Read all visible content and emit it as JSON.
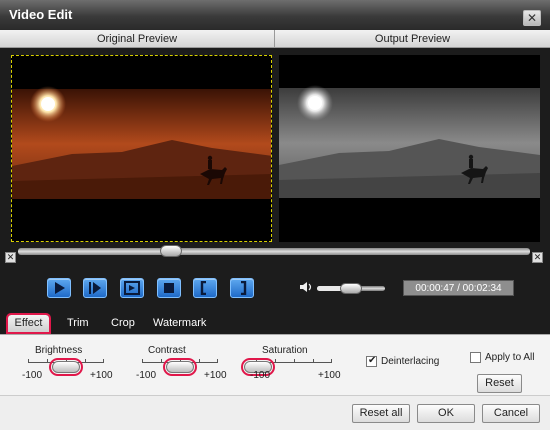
{
  "window": {
    "title": "Video Edit",
    "close_symbol": "✕"
  },
  "panes": {
    "original": "Original Preview",
    "output": "Output Preview"
  },
  "playback": {
    "seek_fraction": 0.29,
    "volume_fraction": 0.5,
    "time": "00:00:47 / 00:02:34",
    "buttons": [
      "play-icon",
      "next-frame-icon",
      "snapshot-icon",
      "stop-icon",
      "mark-start-icon",
      "mark-end-icon"
    ]
  },
  "tabs": [
    "Effect",
    "Trim",
    "Crop",
    "Watermark"
  ],
  "active_tab": "Effect",
  "effects": {
    "brightness": {
      "label": "Brightness",
      "min": "-100",
      "max": "+100",
      "value": 0
    },
    "contrast": {
      "label": "Contrast",
      "min": "-100",
      "max": "+100",
      "value": 0
    },
    "saturation": {
      "label": "Saturation",
      "min": "-100",
      "max": "+100",
      "value": -100
    },
    "deinterlacing": {
      "label": "Deinterlacing",
      "checked": true
    },
    "apply_to_all": {
      "label": "Apply to All",
      "checked": false
    },
    "reset_label": "Reset"
  },
  "footer": {
    "reset_all": "Reset all",
    "ok": "OK",
    "cancel": "Cancel"
  },
  "colors": {
    "accent_highlight": "#e0174a",
    "control_blue": "#1f6ac8",
    "dark_bg": "#1c1c1c"
  }
}
